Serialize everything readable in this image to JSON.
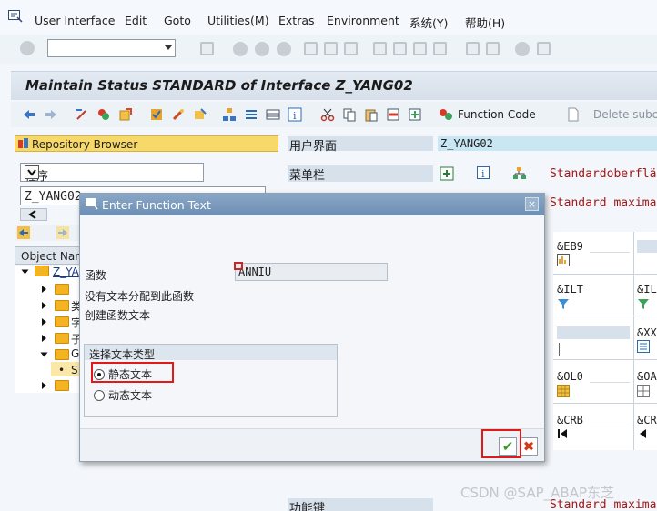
{
  "menubar": {
    "items": [
      "User Interface",
      "Edit",
      "Goto",
      "Utilities(M)",
      "Extras",
      "Environment",
      "系统(Y)",
      "帮助(H)"
    ]
  },
  "title": "Maintain Status STANDARD of Interface Z_YANG02",
  "app_toolbar": {
    "function_code_label": "Function Code",
    "delete_label": "Delete subob"
  },
  "left_nav": {
    "repository_browser": "Repository Browser",
    "object_type": "程序",
    "object_name": "Z_YANG02",
    "tree_header": "Object Nam",
    "tree_root": "Z_YA",
    "tree_items": [
      "类",
      "字",
      "子",
      "G",
      "S"
    ]
  },
  "right_grid": {
    "ui_label": "用户界面",
    "ui_value": "Z_YANG02",
    "menubar_label": "菜单栏",
    "menubar_text": "Standardoberflä",
    "standard_text": "Standard maxima",
    "function_keys_label": "功能键",
    "function_keys_text": "Standard maxima",
    "codes": [
      "&EB9",
      "&ILT",
      "&IL",
      "&XX",
      "&OL0",
      "&OA",
      "&CRB",
      "&CR"
    ]
  },
  "dialog": {
    "title": "Enter Function Text",
    "close_glyph": "×",
    "function_label": "函数",
    "function_code": "ANNIU",
    "msg_no_text": "没有文本分配到此函数",
    "msg_create": "创建函数文本",
    "group_title": "选择文本类型",
    "options": [
      {
        "label": "静态文本",
        "selected": true
      },
      {
        "label": "动态文本",
        "selected": false
      }
    ],
    "confirm_glyph": "✔",
    "cancel_glyph": "✖"
  },
  "watermark": "CSDN @SAP_ABAP东芝",
  "colors": {
    "title_gradient": "#d6dfea",
    "dialog_header": "#6d8fb4",
    "highlight": "#e11919",
    "confirm": "#3a9a2a",
    "cancel": "#d23a1a",
    "repo_button": "#f7d96a",
    "field_value_bg": "#c9e6f3"
  }
}
